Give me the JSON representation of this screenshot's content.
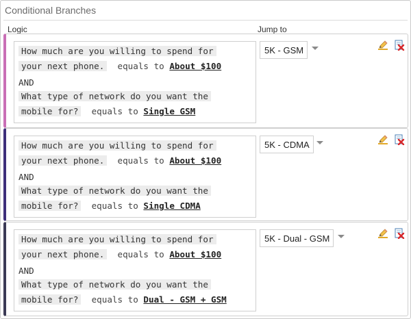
{
  "panel": {
    "title": "Conditional Branches",
    "col_logic": "Logic",
    "col_jump": "Jump to"
  },
  "colors": {
    "branch_1_accent": "#c96fb6",
    "branch_2_accent": "#3e2f7a",
    "branch_3_accent": "#3b3a55"
  },
  "icons": {
    "edit": "pencil-icon",
    "delete": "delete-icon"
  },
  "branches": [
    {
      "q1_line1": "How much are you willing to spend for",
      "q1_line2": "your next phone.",
      "op1": "equals to",
      "val1": "About $100",
      "joiner": "AND",
      "q2_line1": "What type of network do you want the",
      "q2_line2": "mobile for?",
      "op2": "equals to",
      "val2": "Single GSM",
      "jump_to": "5K - GSM"
    },
    {
      "q1_line1": "How much are you willing to spend for",
      "q1_line2": "your next phone.",
      "op1": "equals to",
      "val1": "About $100",
      "joiner": "AND",
      "q2_line1": "What type of network do you want the",
      "q2_line2": "mobile for?",
      "op2": "equals to",
      "val2": "Single CDMA",
      "jump_to": "5K - CDMA"
    },
    {
      "q1_line1": "How much are you willing to spend for",
      "q1_line2": "your next phone.",
      "op1": "equals to",
      "val1": "About $100",
      "joiner": "AND",
      "q2_line1": "What type of network do you want the",
      "q2_line2": "mobile for?",
      "op2": "equals to",
      "val2": "Dual - GSM + GSM",
      "jump_to": "5K - Dual - GSM"
    }
  ]
}
